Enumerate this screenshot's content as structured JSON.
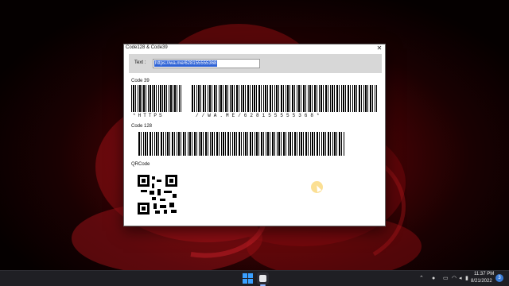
{
  "window": {
    "title": "Code128 & Code39",
    "close_symbol": "✕",
    "text_label": "Text :",
    "text_value": "https://wa.me/628155555368",
    "code39": {
      "label": "Code 39",
      "caption_left": "*HTTPS",
      "caption_right": "//WA.ME/628155555368*"
    },
    "code128": {
      "label": "Code 128"
    },
    "qrcode": {
      "label": "QRCode"
    }
  },
  "taskbar": {
    "time": "11:37 PM",
    "date": "8/21/2022",
    "notification_count": "3",
    "icons": [
      "windows-start-icon",
      "barcode-app-icon",
      "chevron-up-icon",
      "microphone-icon",
      "language-icon",
      "wifi-icon",
      "speaker-icon",
      "battery-icon"
    ]
  },
  "colors": {
    "selection": "#2f63d6",
    "text_panel": "#d7d7d7",
    "taskbar": "#1f1f24",
    "wallpaper_accent": "#7a0a0c"
  }
}
